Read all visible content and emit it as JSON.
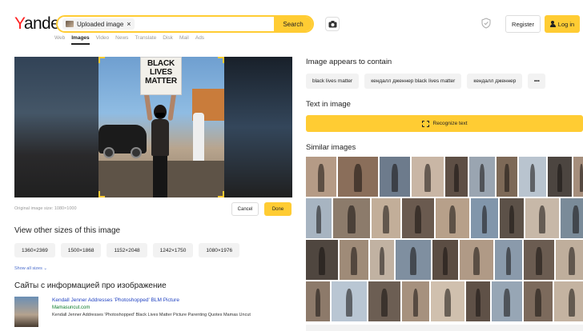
{
  "header": {
    "logo_letter": "Y",
    "logo_rest": "andex",
    "search_chip": "Uploaded image",
    "search_button": "Search",
    "register": "Register",
    "login": "Log in"
  },
  "tabs": [
    {
      "label": "Web",
      "active": false
    },
    {
      "label": "Images",
      "active": true
    },
    {
      "label": "Video",
      "active": false
    },
    {
      "label": "News",
      "active": false
    },
    {
      "label": "Translate",
      "active": false
    },
    {
      "label": "Disk",
      "active": false
    },
    {
      "label": "Mail",
      "active": false
    },
    {
      "label": "Ads",
      "active": false
    }
  ],
  "image_panel": {
    "sign_text": "BLACK LIVES MATTER",
    "original_size": "Original image size: 1080×1000",
    "cancel": "Cancel",
    "done": "Done"
  },
  "sizes": {
    "heading": "View other sizes of this image",
    "items": [
      "1360×2369",
      "1500×1868",
      "1152×2048",
      "1242×1750",
      "1080×1976"
    ],
    "show_all": "Show all sizes ⌄"
  },
  "sites": {
    "heading": "Сайты с информацией про изображение",
    "result": {
      "title": "Kendall Jenner Addresses 'Photoshopped' BLM Picture",
      "domain": "Mamasuncut.com",
      "snippet": "Kendall Jenner Addresses 'Photoshopped' Black Lives Matter Picture Parenting Quotes Mamas Uncut"
    }
  },
  "contains": {
    "heading": "Image appears to contain",
    "tags": [
      "black lives matter",
      "кендалл дженнер black lives matter",
      "кендалл дженнер"
    ],
    "more": "•••"
  },
  "text_in_image": {
    "heading": "Text in image",
    "button": "Recognize text"
  },
  "similar": {
    "heading": "Similar images",
    "rows": [
      {
        "widths": [
          38,
          50,
          38,
          40,
          28,
          32,
          26,
          34,
          30,
          20
        ],
        "colors": [
          "#b59b86",
          "#8a6e5a",
          "#6d7b8c",
          "#c9b6a5",
          "#5e4f45",
          "#9aa5b1",
          "#7d6957",
          "#b9c4cf",
          "#4c4540",
          "#a58e7c"
        ]
      },
      {
        "widths": [
          32,
          46,
          36,
          40,
          42,
          34,
          30,
          42,
          38
        ],
        "colors": [
          "#a7b4c1",
          "#8c7b6b",
          "#c2ae99",
          "#6a5a4f",
          "#b7a08a",
          "#8196ab",
          "#5c5148",
          "#c7b8a8",
          "#7a8b99"
        ]
      },
      {
        "widths": [
          40,
          36,
          30,
          44,
          32,
          42,
          34,
          38,
          40
        ],
        "colors": [
          "#4f463f",
          "#9f8b78",
          "#c1b2a2",
          "#7f8fa0",
          "#5b4d43",
          "#b09a86",
          "#8a9aab",
          "#6b5c51",
          "#bfae9c"
        ]
      },
      {
        "widths": [
          30,
          44,
          40,
          34,
          42,
          30,
          38,
          36,
          44
        ],
        "colors": [
          "#8d7a6a",
          "#b9c6d3",
          "#6c5e53",
          "#a6917e",
          "#d0c0ae",
          "#5f5147",
          "#97a6b5",
          "#7c6a5c",
          "#c4b3a1"
        ]
      }
    ]
  }
}
